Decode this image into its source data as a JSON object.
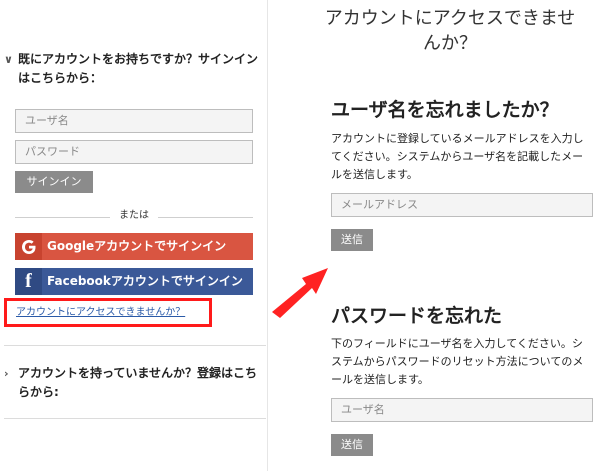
{
  "left": {
    "have_account_heading": "既にアカウントをお持ちですか？サインインはこちらから：",
    "username_placeholder": "ユーザ名",
    "password_placeholder": "パスワード",
    "signin_label": "サインイン",
    "or_label": "または",
    "google_label": "Googleアカウントでサインイン",
    "facebook_label": "Facebookアカウントでサインイン",
    "cant_access_link": "アカウントにアクセスできませんか？",
    "no_account_heading": "アカウントを持っていませんか？登録はこちらから:"
  },
  "right": {
    "title": "アカウントにアクセスできませんか？",
    "forgot_username": {
      "heading": "ユーザ名を忘れましたか？",
      "description": "アカウントに登録しているメールアドレスを入力してください。システムからユーザ名を記載したメールを送信します。",
      "email_placeholder": "メールアドレス",
      "send_label": "送信"
    },
    "forgot_password": {
      "heading": "パスワードを忘れた",
      "description": "下のフィールドにユーザ名を入力してください。システムからパスワードのリセット方法についてのメールを送信します。",
      "username_placeholder": "ユーザ名",
      "send_label": "送信"
    }
  },
  "colors": {
    "highlight": "#ff1a1a",
    "google": "#d95541",
    "facebook": "#3b5998",
    "button_gray": "#8b8b8b",
    "link": "#2a5aa8"
  },
  "icons": [
    "chevron-down-icon",
    "google-icon",
    "facebook-icon",
    "chevron-right-icon",
    "arrow-icon"
  ]
}
